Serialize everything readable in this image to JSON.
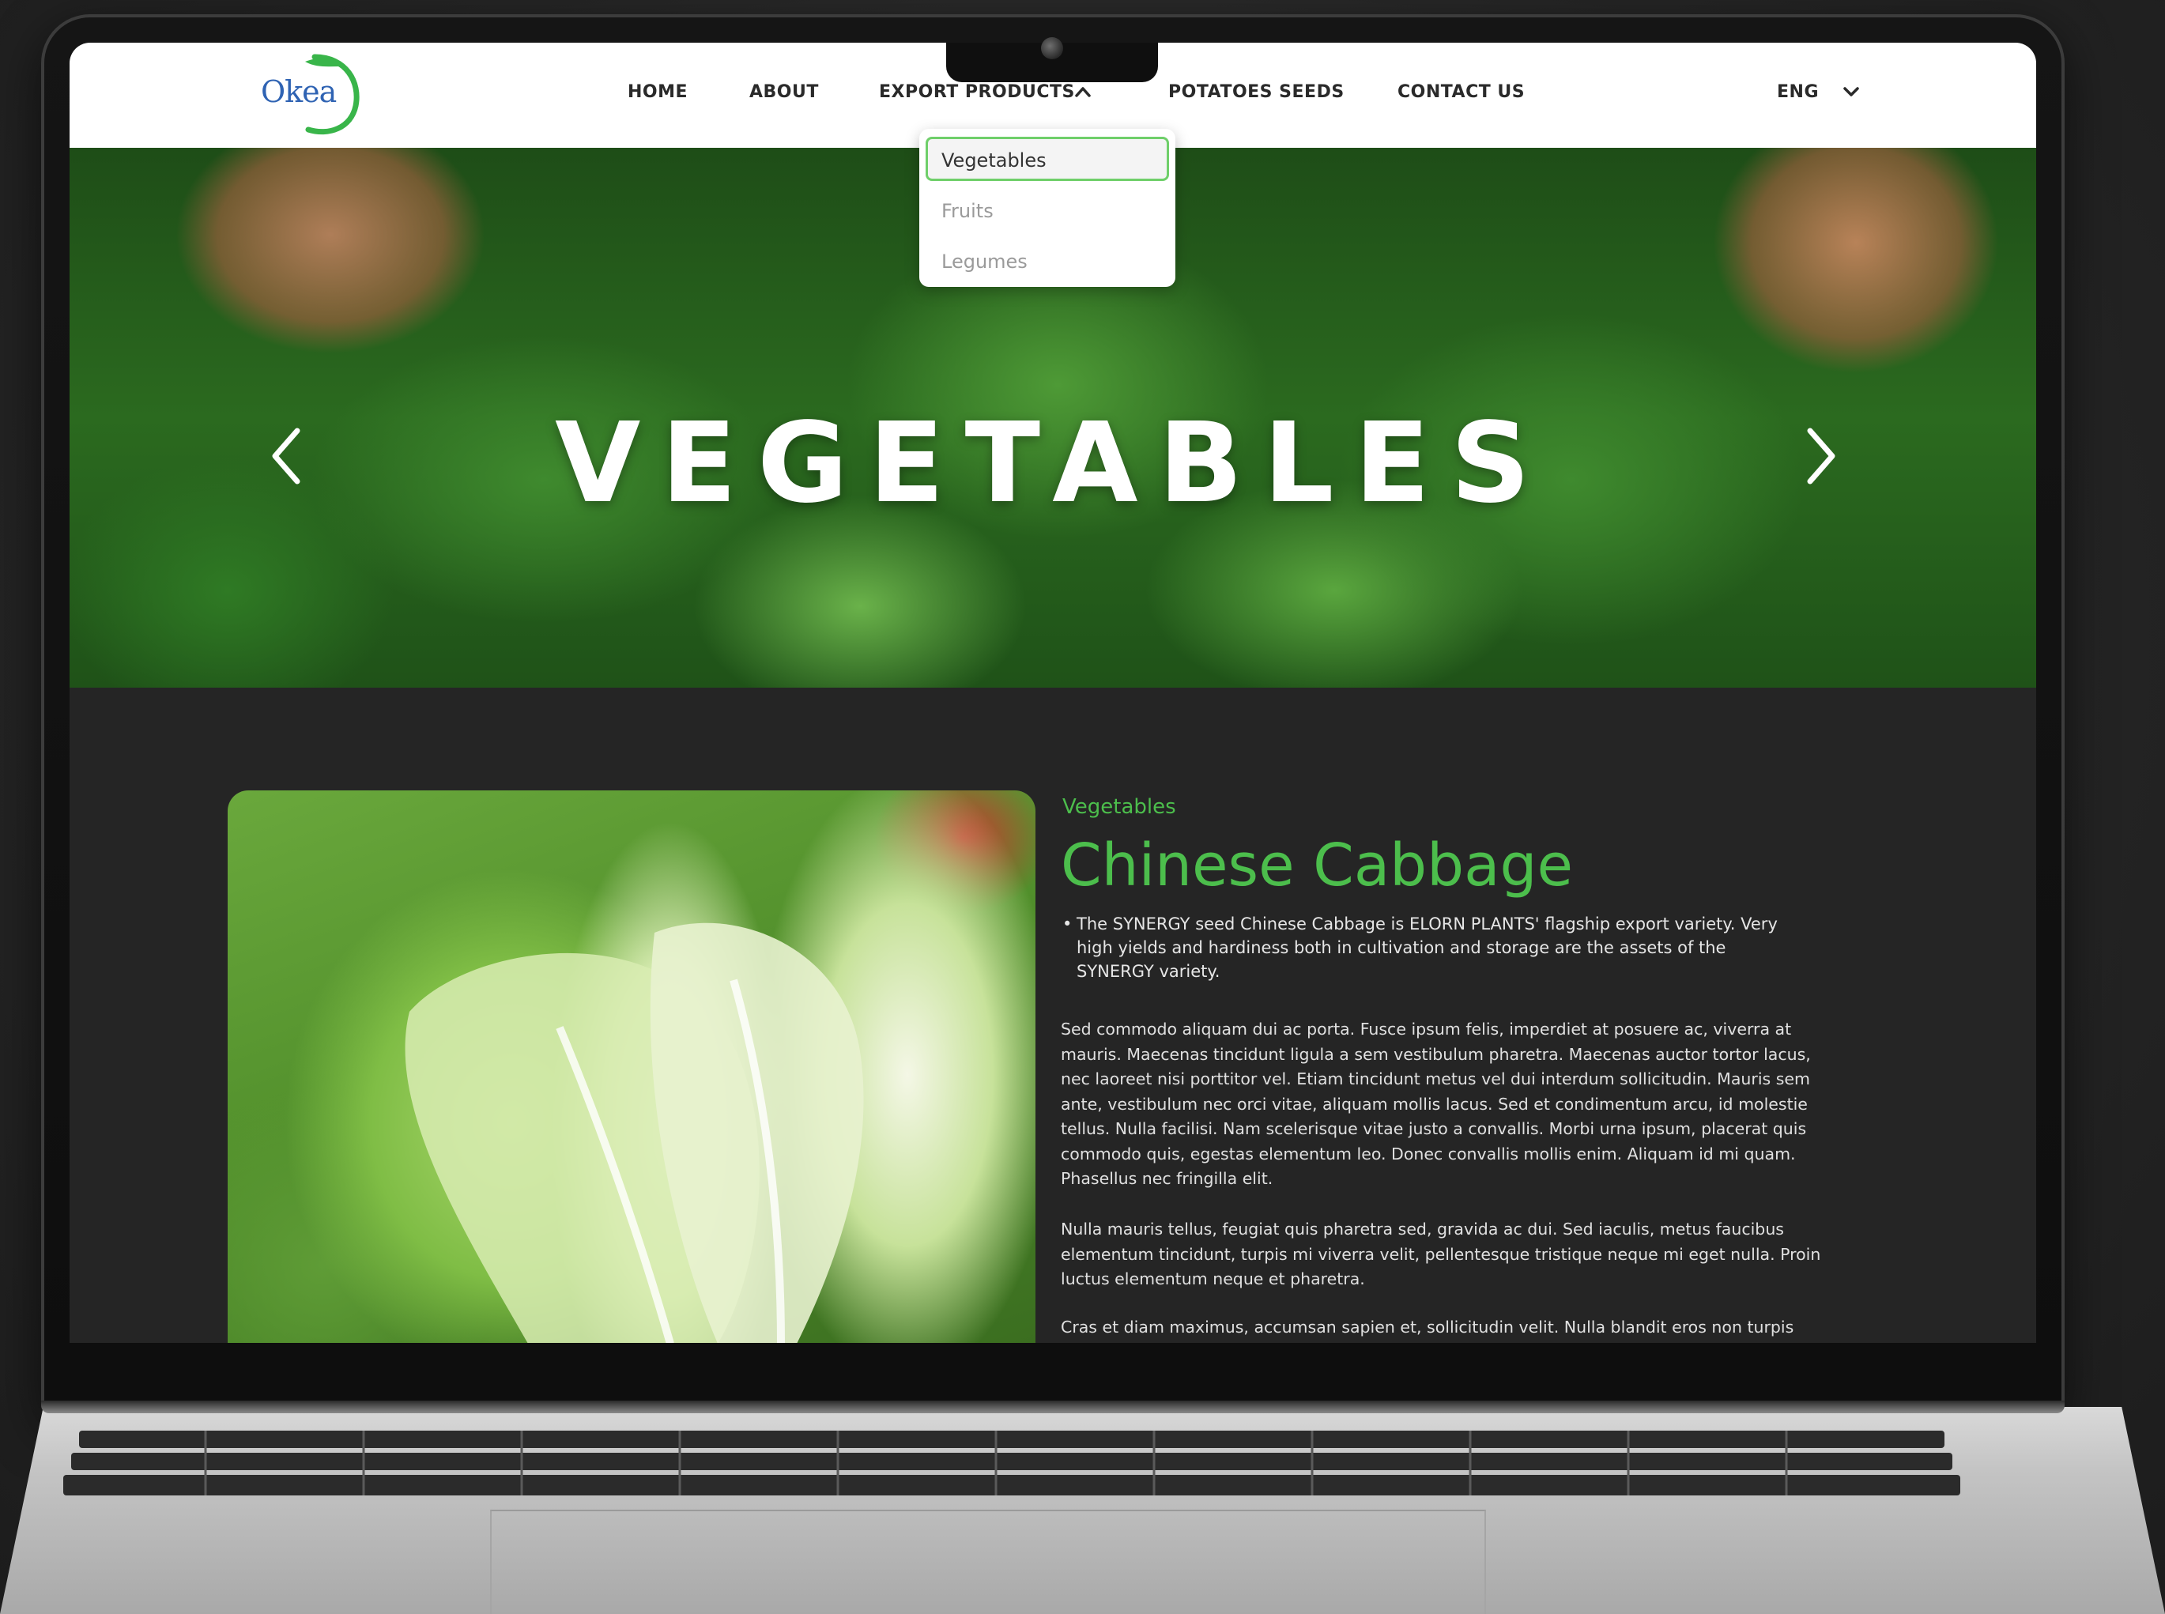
{
  "nav": {
    "logo_text": "Okea",
    "items": [
      "HOME",
      "ABOUT",
      "EXPORT PRODUCTS",
      "POTATOES SEEDS",
      "CONTACT US"
    ],
    "language": "ENG"
  },
  "dropdown": {
    "items": [
      "Vegetables",
      "Fruits",
      "Legumes"
    ],
    "selected": "Vegetables"
  },
  "hero": {
    "title": "VEGETABLES"
  },
  "product": {
    "category": "Vegetables",
    "title": "Chinese Cabbage",
    "bullet": "The SYNERGY seed Chinese Cabbage is ELORN PLANTS' flagship export variety. Very high yields and hardiness both in cultivation and storage are the assets of the SYNERGY variety.",
    "paragraphs": [
      "Sed commodo aliquam dui ac porta. Fusce ipsum felis, imperdiet at posuere ac, viverra at mauris. Maecenas tincidunt ligula a sem vestibulum pharetra. Maecenas auctor tortor lacus, nec laoreet nisi porttitor vel. Etiam tincidunt metus vel dui interdum sollicitudin. Mauris sem ante, vestibulum nec orci vitae, aliquam mollis lacus. Sed et condimentum arcu, id molestie tellus. Nulla facilisi. Nam scelerisque vitae justo a convallis. Morbi urna ipsum, placerat quis commodo quis, egestas elementum leo. Donec convallis mollis enim. Aliquam id mi quam. Phasellus nec fringilla elit.",
      "Nulla mauris tellus, feugiat quis pharetra sed, gravida ac dui. Sed iaculis, metus faucibus elementum tincidunt, turpis mi viverra velit, pellentesque tristique neque mi eget nulla. Proin luctus elementum neque et pharetra.",
      "Cras et diam maximus, accumsan sapien et, sollicitudin velit. Nulla blandit eros non turpis"
    ]
  },
  "colors": {
    "accent_green": "#4cbe4c",
    "dropdown_border": "#6fcf6a",
    "content_bg": "#252525"
  },
  "icons": [
    "chevron-up-icon",
    "chevron-down-icon",
    "chevron-left-icon",
    "chevron-right-icon",
    "bullet-icon"
  ]
}
